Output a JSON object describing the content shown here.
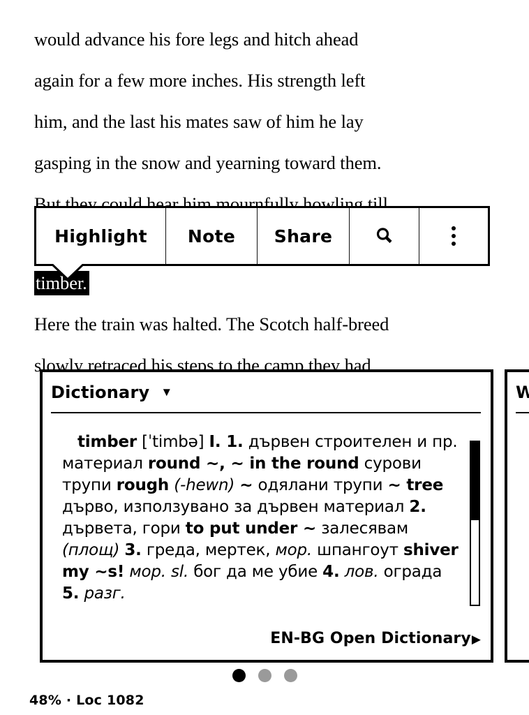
{
  "book": {
    "lines": [
      "would advance his fore legs and hitch ahead",
      "again for a few more inches. His strength left",
      "him, and the last his mates saw of him he lay",
      "gasping in the snow and yearning toward them.",
      "But they could hear him mournfully howling till",
      "Here the train was halted. The Scotch half-breed",
      "slowly retraced his steps to the camp they had"
    ],
    "selected_word": "timber."
  },
  "toolbar": {
    "highlight_label": "Highlight",
    "note_label": "Note",
    "share_label": "Share",
    "search_icon": "search-icon",
    "more_icon": "more-vertical-icon"
  },
  "dictionary": {
    "title": "Dictionary",
    "caret": "▼",
    "entry": {
      "headword": "timber",
      "pronunciation": "[ˈtimbə]",
      "roman": "I.",
      "full_text": "timber [ˈtimbə] I. 1. дървен строителен и пр. материал round ~, ~ in the round сурови трупи rough (-hewn) ~ одялани трупи ~ tree дърво, използувано за дървен материал 2. дървета, гори to put under ~ залесявам (площ) 3. греда, мертек, мор. шпангоут shiver my ~s! мор. sl. бог да ме убие 4. лов. ограда 5. разг."
    },
    "source_label": "EN-BG Open Dictionary",
    "source_caret": "▶",
    "scroll_percent": 48
  },
  "wikipedia_panel": {
    "title": "W"
  },
  "pager": {
    "count": 3,
    "active_index": 0
  },
  "status": {
    "text": "48% · Loc 1082",
    "progress_percent": "48%",
    "location": "Loc 1082"
  },
  "colors": {
    "ink": "#000000",
    "paper": "#ffffff",
    "dot_inactive": "#9a9a9a"
  }
}
